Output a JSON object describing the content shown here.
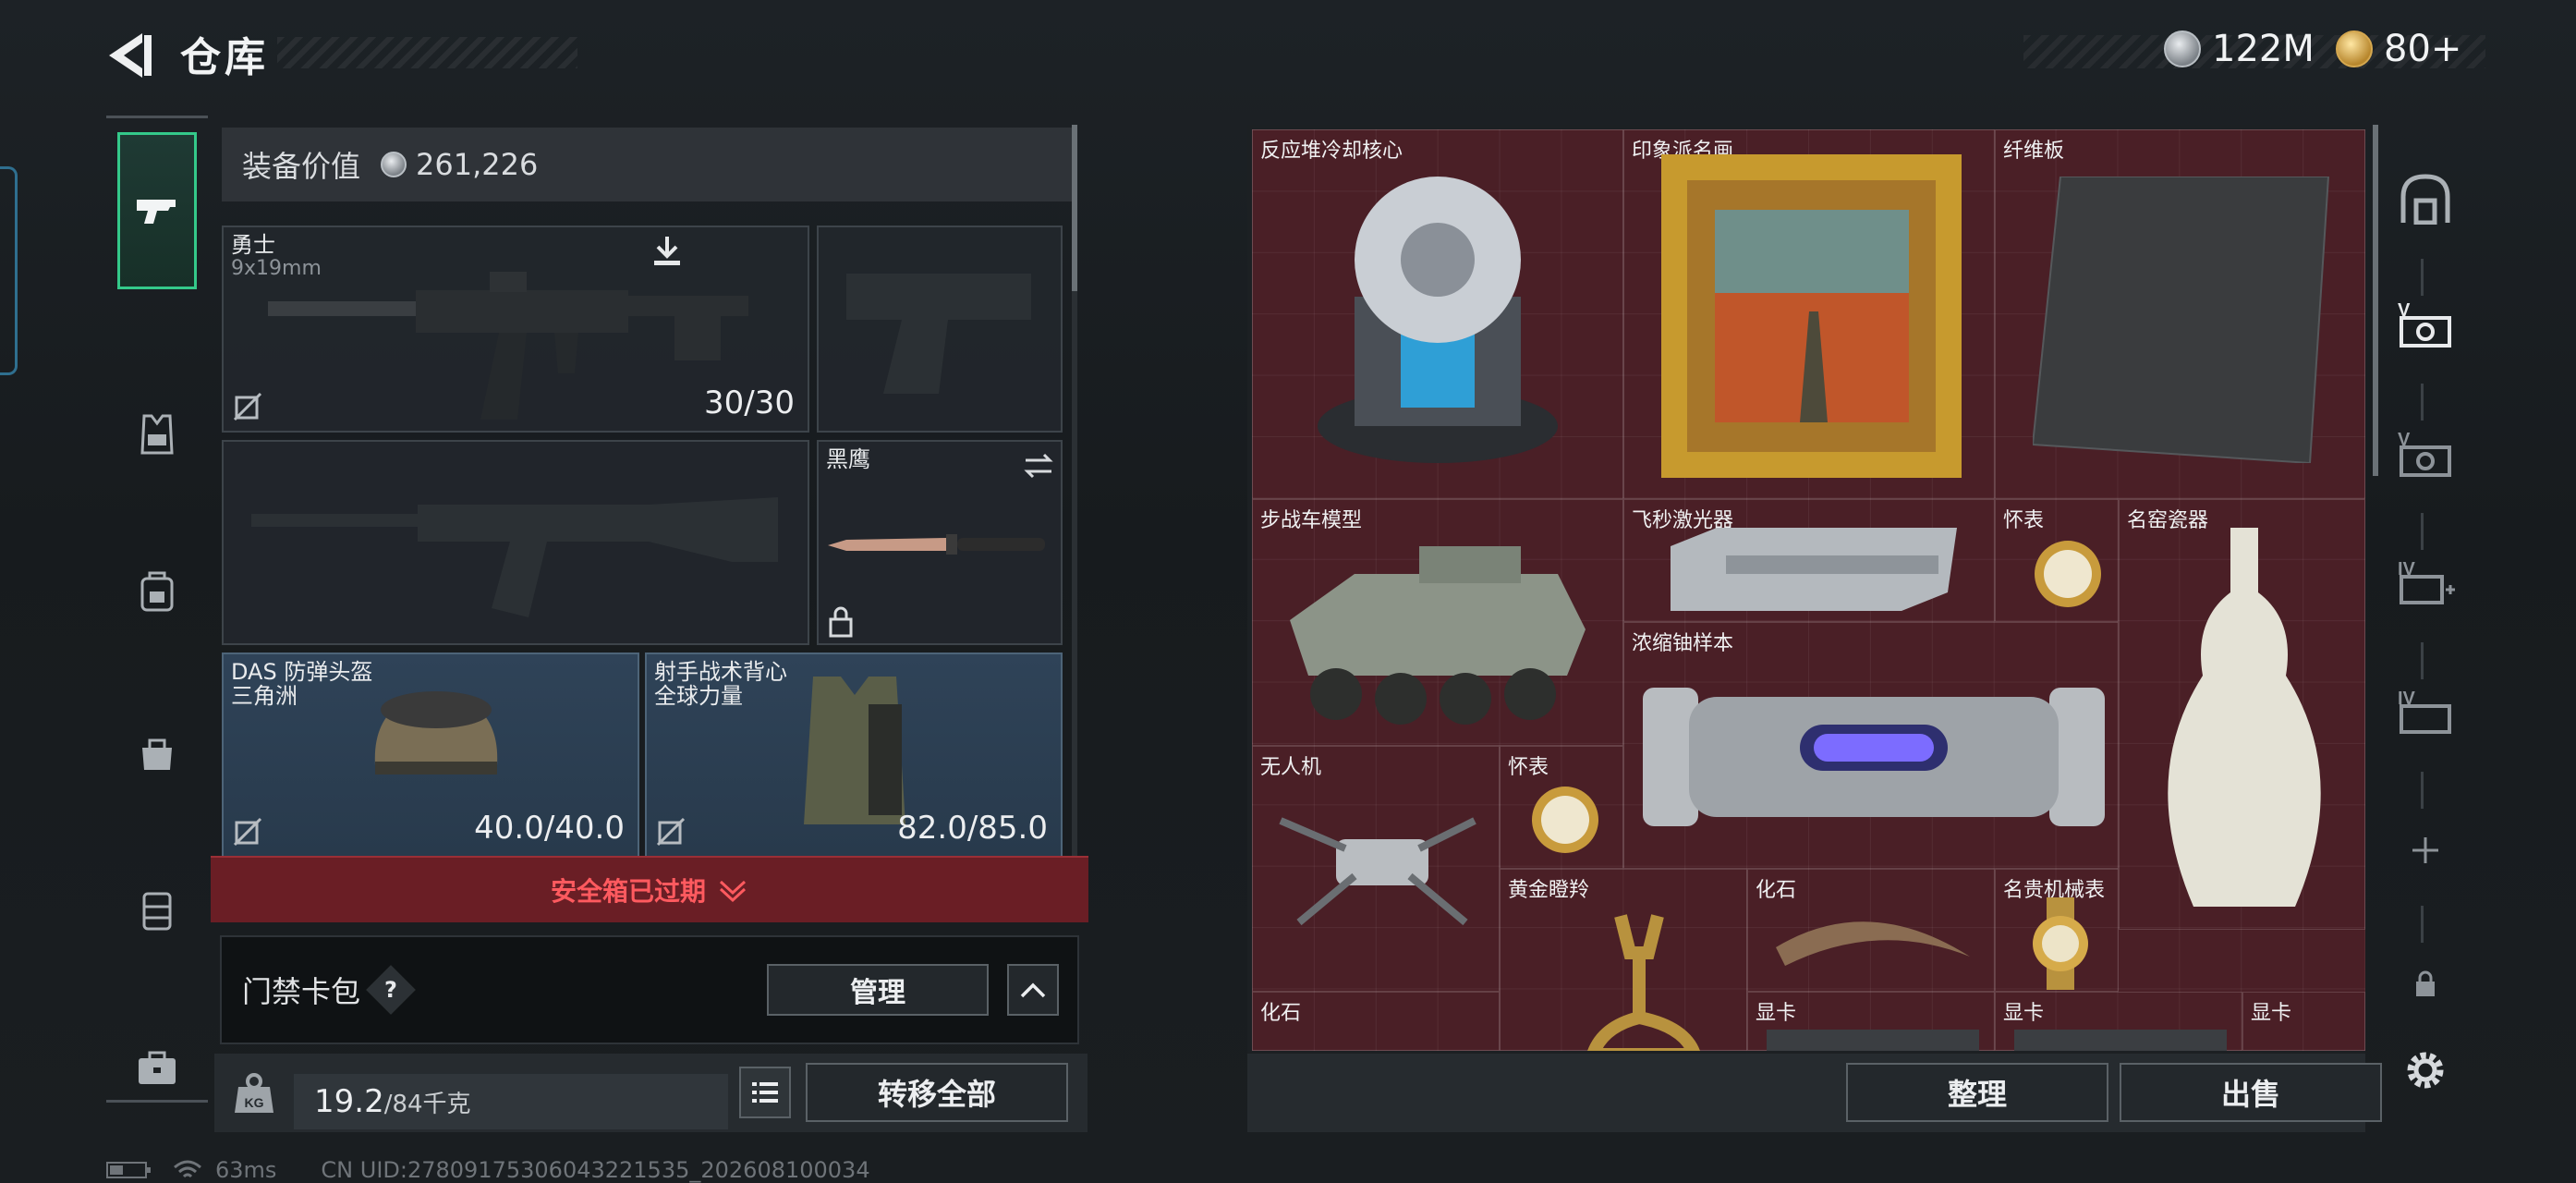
{
  "header": {
    "title": "仓库",
    "currencies": [
      {
        "icon": "silver-coin-icon",
        "value": "122M"
      },
      {
        "icon": "gold-coin-icon",
        "value": "80+"
      }
    ]
  },
  "left_nav": {
    "items": [
      {
        "name": "nav-weapons",
        "icon": "pistol-icon",
        "active": true
      },
      {
        "name": "nav-armor-rig",
        "icon": "vest-icon",
        "active": false
      },
      {
        "name": "nav-backpack",
        "icon": "backpack-icon",
        "active": false
      },
      {
        "name": "nav-bag",
        "icon": "bag-icon",
        "active": false
      },
      {
        "name": "nav-container",
        "icon": "container-icon",
        "active": false
      },
      {
        "name": "nav-case",
        "icon": "briefcase-icon",
        "active": false
      }
    ]
  },
  "loadout": {
    "value_label": "装备价值",
    "value": "261,226",
    "primary_weapon": {
      "name": "勇士",
      "caliber": "9x19mm",
      "ammo": "30/30"
    },
    "melee": {
      "name": "黑鹰"
    },
    "helmet": {
      "name": "DAS 防弹头盔",
      "sub": "三角洲",
      "durability": "40.0/40.0"
    },
    "armor": {
      "name": "射手战术背心",
      "sub": "全球力量",
      "durability": "82.0/85.0"
    },
    "safebox_text": "安全箱已过期",
    "keycard_label": "门禁卡包",
    "keycard_help": "?",
    "manage_label": "管理",
    "weight_value": "19.2",
    "weight_max": "/84千克",
    "transfer_all_label": "转移全部"
  },
  "stash": {
    "items": [
      {
        "label": "反应堆冷却核心"
      },
      {
        "label": "印象派名画"
      },
      {
        "label": "纤维板"
      },
      {
        "label": "步战车模型"
      },
      {
        "label": "飞秒激光器"
      },
      {
        "label": "怀表"
      },
      {
        "label": "名窑瓷器"
      },
      {
        "label": "浓缩铀样本"
      },
      {
        "label": "无人机"
      },
      {
        "label": "怀表"
      },
      {
        "label": "黄金瞪羚"
      },
      {
        "label": "化石"
      },
      {
        "label": "名贵机械表"
      },
      {
        "label": "化石"
      },
      {
        "label": "显卡"
      },
      {
        "label": "显卡"
      },
      {
        "label": "显卡"
      }
    ],
    "sort_label": "整理",
    "sell_label": "出售"
  },
  "right_tabs": [
    {
      "icon": "stash-tab-icon"
    },
    {
      "icon": "tab-v-icon",
      "label": "V"
    },
    {
      "icon": "tab-v-icon",
      "label": "V"
    },
    {
      "icon": "tab-iv-add-icon",
      "label": "IV"
    },
    {
      "icon": "tab-iv-icon",
      "label": "IV"
    },
    {
      "icon": "add-tab-icon"
    },
    {
      "icon": "lock-icon"
    },
    {
      "icon": "gear-icon"
    }
  ],
  "footer": {
    "ping": "63ms",
    "uid": "CN UID:27809175306043221535_202608100034"
  },
  "colors": {
    "stash_bg": "#4a1f26",
    "active_nav": "#34c98a",
    "safebox_red": "#ff5a5f"
  }
}
